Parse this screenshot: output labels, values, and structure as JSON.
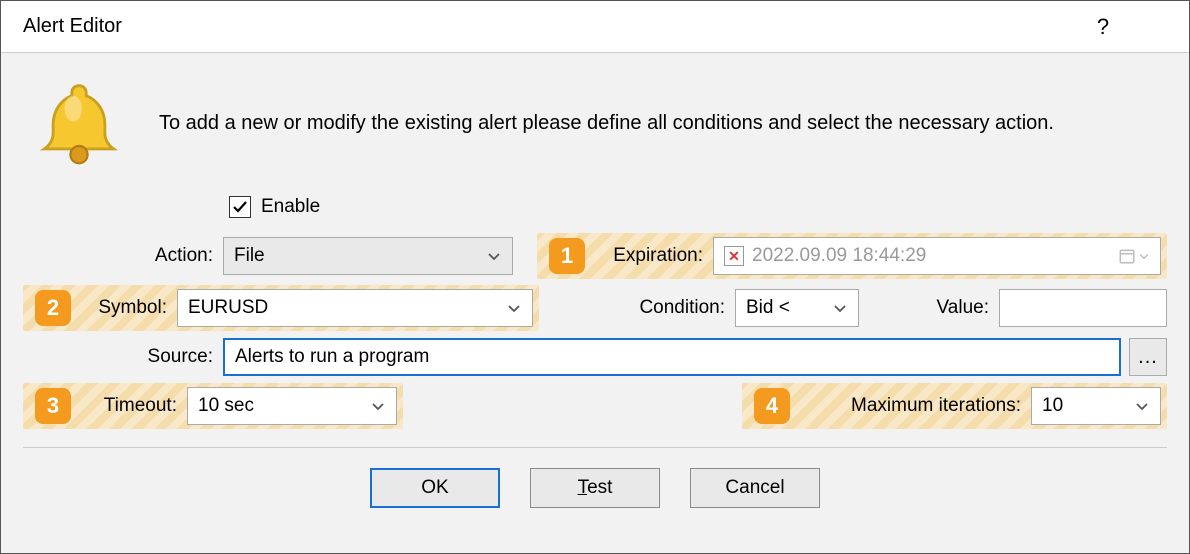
{
  "title": "Alert Editor",
  "intro": "To add a new or modify the existing alert please define all conditions and select the necessary action.",
  "enable": {
    "label": "Enable",
    "checked": true
  },
  "action": {
    "label": "Action:",
    "value": "File"
  },
  "expiration": {
    "label": "Expiration:",
    "value": "2022.09.09 18:44:29",
    "cleared": true
  },
  "symbol": {
    "label": "Symbol:",
    "value": "EURUSD"
  },
  "condition": {
    "label": "Condition:",
    "value": "Bid <"
  },
  "value": {
    "label": "Value:",
    "value": ""
  },
  "source": {
    "label": "Source:",
    "value": "Alerts to run a program"
  },
  "timeout": {
    "label": "Timeout:",
    "value": "10 sec"
  },
  "maxiter": {
    "label": "Maximum iterations:",
    "value": "10"
  },
  "badges": {
    "b1": "1",
    "b2": "2",
    "b3": "3",
    "b4": "4"
  },
  "buttons": {
    "ok": "OK",
    "test": "Test",
    "cancel": "Cancel",
    "browse": "..."
  }
}
